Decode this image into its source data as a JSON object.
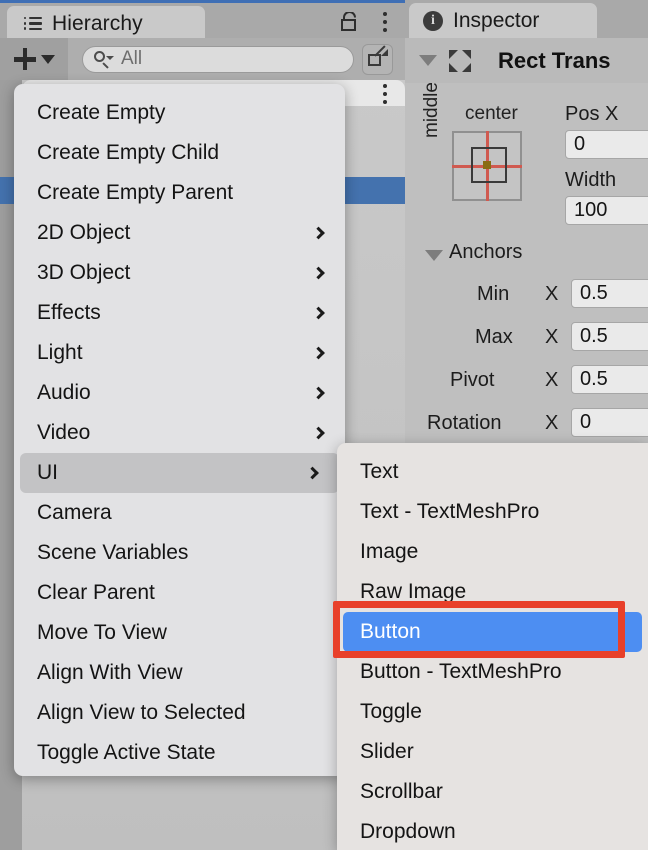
{
  "hierarchy": {
    "tab_label": "Hierarchy",
    "tab_icon": "list-icon",
    "lock_icon": "lock-icon",
    "kebab_icon": "kebab-menu-icon",
    "toolbar": {
      "create_label": "+",
      "create_dropdown_icon": "chevron-down-icon",
      "search_icon": "search-icon",
      "search_value": "",
      "search_placeholder": "All",
      "expand_icon": "open-in-new-window-icon"
    }
  },
  "inspector": {
    "tab_label": "Inspector",
    "tab_icon": "info-icon",
    "component": {
      "foldout_icon": "triangle-down-icon",
      "component_icon": "rect-transform-icon",
      "title": "Rect Trans"
    },
    "anchor_preset": {
      "horizontal": "center",
      "vertical": "middle"
    },
    "fields": [
      {
        "label": "Pos X",
        "value": "0"
      },
      {
        "label": "Width",
        "value": "100"
      }
    ],
    "anchors": {
      "section_label": "Anchors",
      "foldout_icon": "triangle-down-icon",
      "rows": [
        {
          "label": "Min",
          "axis": "X",
          "value": "0.5"
        },
        {
          "label": "Max",
          "axis": "X",
          "value": "0.5"
        },
        {
          "label": "Pivot",
          "axis": "X",
          "value": "0.5"
        }
      ]
    },
    "rotation": {
      "label": "Rotation",
      "axis": "X",
      "value": "0"
    }
  },
  "context_menu": {
    "items": [
      {
        "label": "Create Empty",
        "submenu": false,
        "highlight": false
      },
      {
        "label": "Create Empty Child",
        "submenu": false,
        "highlight": false
      },
      {
        "label": "Create Empty Parent",
        "submenu": false,
        "highlight": false
      },
      {
        "label": "2D Object",
        "submenu": true,
        "highlight": false
      },
      {
        "label": "3D Object",
        "submenu": true,
        "highlight": false
      },
      {
        "label": "Effects",
        "submenu": true,
        "highlight": false
      },
      {
        "label": "Light",
        "submenu": true,
        "highlight": false
      },
      {
        "label": "Audio",
        "submenu": true,
        "highlight": false
      },
      {
        "label": "Video",
        "submenu": true,
        "highlight": false
      },
      {
        "label": "UI",
        "submenu": true,
        "highlight": true
      },
      {
        "label": "Camera",
        "submenu": false,
        "highlight": false
      },
      {
        "label": "Scene Variables",
        "submenu": false,
        "highlight": false
      },
      {
        "label": "Clear Parent",
        "submenu": false,
        "highlight": false
      },
      {
        "label": "Move To View",
        "submenu": false,
        "highlight": false
      },
      {
        "label": "Align With View",
        "submenu": false,
        "highlight": false
      },
      {
        "label": "Align View to Selected",
        "submenu": false,
        "highlight": false
      },
      {
        "label": "Toggle Active State",
        "submenu": false,
        "highlight": false
      }
    ]
  },
  "ui_submenu": {
    "items": [
      {
        "label": "Text",
        "selected": false
      },
      {
        "label": "Text - TextMeshPro",
        "selected": false
      },
      {
        "label": "Image",
        "selected": false
      },
      {
        "label": "Raw Image",
        "selected": false
      },
      {
        "label": "Button",
        "selected": true
      },
      {
        "label": "Button - TextMeshPro",
        "selected": false
      },
      {
        "label": "Toggle",
        "selected": false
      },
      {
        "label": "Slider",
        "selected": false
      },
      {
        "label": "Scrollbar",
        "selected": false
      },
      {
        "label": "Dropdown",
        "selected": false
      }
    ]
  },
  "annotation": {
    "target_label": "Button",
    "color": "#e8402a"
  },
  "colors": {
    "selection_blue": "#4d8ef2",
    "hierarchy_row_blue": "#4472ae",
    "annotation_red": "#e8402a",
    "panel_gray": "#bfbfbf",
    "menu_gray": "#e2e2e4"
  }
}
